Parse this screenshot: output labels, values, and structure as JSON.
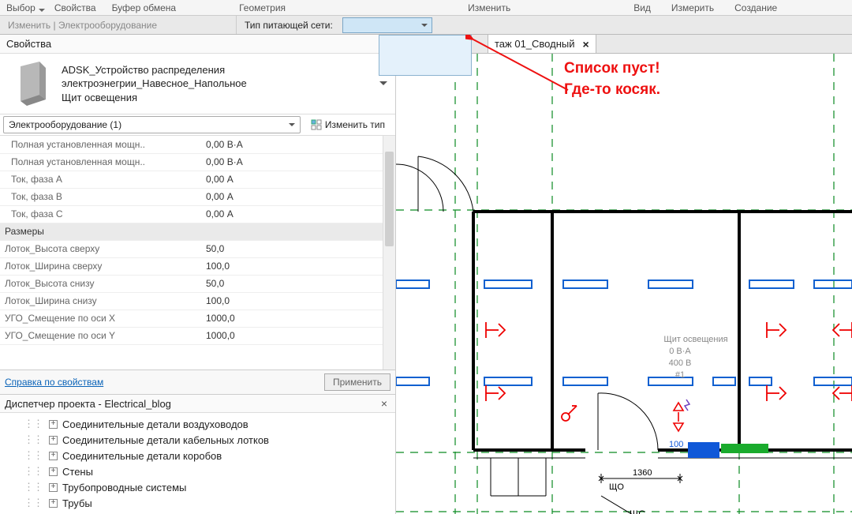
{
  "ribbon": {
    "groups": [
      "Выбор",
      "Свойства",
      "Буфер обмена",
      "Геометрия",
      "Изменить",
      "Вид",
      "Измерить",
      "Создание"
    ]
  },
  "option_bar": {
    "modify_label": "Изменить | Электрооборудование",
    "supply_label": "Тип питающей сети:"
  },
  "properties": {
    "panel_title": "Свойства",
    "family": "ADSK_Устройство распределения электроэнегрии_Навесное_Напольное",
    "type_name": "Щит освещения",
    "category_count": "Электрооборудование (1)",
    "edit_type": "Изменить тип",
    "rows": [
      {
        "label": "Полная установленная мощн..",
        "value": "0,00 В·А",
        "indent": true
      },
      {
        "label": "Полная установленная мощн..",
        "value": "0,00 В·А",
        "indent": true
      },
      {
        "label": "Ток, фаза A",
        "value": "0,00 А",
        "indent": true
      },
      {
        "label": "Ток, фаза B",
        "value": "0,00 А",
        "indent": true
      },
      {
        "label": "Ток, фаза C",
        "value": "0,00 А",
        "indent": true
      }
    ],
    "group_dims": "Размеры",
    "dim_rows": [
      {
        "label": "Лоток_Высота сверху",
        "value": "50,0"
      },
      {
        "label": "Лоток_Ширина сверху",
        "value": "100,0"
      },
      {
        "label": "Лоток_Высота снизу",
        "value": "50,0"
      },
      {
        "label": "Лоток_Ширина снизу",
        "value": "100,0"
      },
      {
        "label": "УГО_Смещение по оси X",
        "value": "1000,0"
      },
      {
        "label": "УГО_Смещение по оси Y",
        "value": "1000,0"
      }
    ],
    "help_link": "Справка по свойствам",
    "apply": "Применить"
  },
  "browser": {
    "title": "Диспетчер проекта - Electrical_blog",
    "nodes": [
      "Соединительные детали воздуховодов",
      "Соединительные детали кабельных лотков",
      "Соединительные детали коробов",
      "Стены",
      "Трубопроводные системы",
      "Трубы"
    ]
  },
  "view": {
    "tab_title": "таж 01_Сводный",
    "panel_label": "Щит освещения",
    "panel_va": "0 В·А",
    "panel_volt": "400 В",
    "panel_id": "#1",
    "dim1": "1360",
    "dim2": "100",
    "tag1": "ЩО",
    "tag2": "ЩС"
  },
  "annotation": {
    "line1": "Список пуст!",
    "line2": "Где-то косяк."
  }
}
